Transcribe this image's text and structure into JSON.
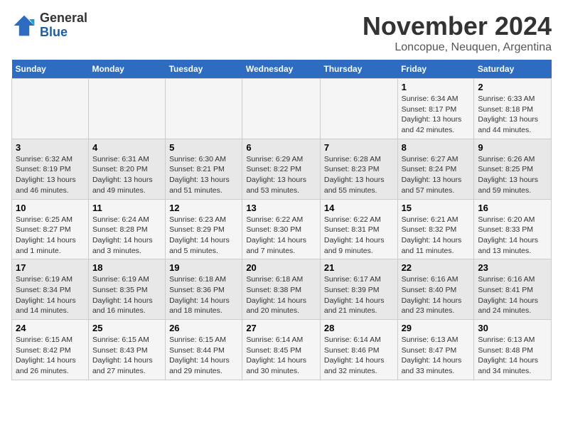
{
  "header": {
    "logo_general": "General",
    "logo_blue": "Blue",
    "title": "November 2024",
    "subtitle": "Loncopue, Neuquen, Argentina"
  },
  "weekdays": [
    "Sunday",
    "Monday",
    "Tuesday",
    "Wednesday",
    "Thursday",
    "Friday",
    "Saturday"
  ],
  "weeks": [
    [
      {
        "day": "",
        "detail": ""
      },
      {
        "day": "",
        "detail": ""
      },
      {
        "day": "",
        "detail": ""
      },
      {
        "day": "",
        "detail": ""
      },
      {
        "day": "",
        "detail": ""
      },
      {
        "day": "1",
        "detail": "Sunrise: 6:34 AM\nSunset: 8:17 PM\nDaylight: 13 hours and 42 minutes."
      },
      {
        "day": "2",
        "detail": "Sunrise: 6:33 AM\nSunset: 8:18 PM\nDaylight: 13 hours and 44 minutes."
      }
    ],
    [
      {
        "day": "3",
        "detail": "Sunrise: 6:32 AM\nSunset: 8:19 PM\nDaylight: 13 hours and 46 minutes."
      },
      {
        "day": "4",
        "detail": "Sunrise: 6:31 AM\nSunset: 8:20 PM\nDaylight: 13 hours and 49 minutes."
      },
      {
        "day": "5",
        "detail": "Sunrise: 6:30 AM\nSunset: 8:21 PM\nDaylight: 13 hours and 51 minutes."
      },
      {
        "day": "6",
        "detail": "Sunrise: 6:29 AM\nSunset: 8:22 PM\nDaylight: 13 hours and 53 minutes."
      },
      {
        "day": "7",
        "detail": "Sunrise: 6:28 AM\nSunset: 8:23 PM\nDaylight: 13 hours and 55 minutes."
      },
      {
        "day": "8",
        "detail": "Sunrise: 6:27 AM\nSunset: 8:24 PM\nDaylight: 13 hours and 57 minutes."
      },
      {
        "day": "9",
        "detail": "Sunrise: 6:26 AM\nSunset: 8:25 PM\nDaylight: 13 hours and 59 minutes."
      }
    ],
    [
      {
        "day": "10",
        "detail": "Sunrise: 6:25 AM\nSunset: 8:27 PM\nDaylight: 14 hours and 1 minute."
      },
      {
        "day": "11",
        "detail": "Sunrise: 6:24 AM\nSunset: 8:28 PM\nDaylight: 14 hours and 3 minutes."
      },
      {
        "day": "12",
        "detail": "Sunrise: 6:23 AM\nSunset: 8:29 PM\nDaylight: 14 hours and 5 minutes."
      },
      {
        "day": "13",
        "detail": "Sunrise: 6:22 AM\nSunset: 8:30 PM\nDaylight: 14 hours and 7 minutes."
      },
      {
        "day": "14",
        "detail": "Sunrise: 6:22 AM\nSunset: 8:31 PM\nDaylight: 14 hours and 9 minutes."
      },
      {
        "day": "15",
        "detail": "Sunrise: 6:21 AM\nSunset: 8:32 PM\nDaylight: 14 hours and 11 minutes."
      },
      {
        "day": "16",
        "detail": "Sunrise: 6:20 AM\nSunset: 8:33 PM\nDaylight: 14 hours and 13 minutes."
      }
    ],
    [
      {
        "day": "17",
        "detail": "Sunrise: 6:19 AM\nSunset: 8:34 PM\nDaylight: 14 hours and 14 minutes."
      },
      {
        "day": "18",
        "detail": "Sunrise: 6:19 AM\nSunset: 8:35 PM\nDaylight: 14 hours and 16 minutes."
      },
      {
        "day": "19",
        "detail": "Sunrise: 6:18 AM\nSunset: 8:36 PM\nDaylight: 14 hours and 18 minutes."
      },
      {
        "day": "20",
        "detail": "Sunrise: 6:18 AM\nSunset: 8:38 PM\nDaylight: 14 hours and 20 minutes."
      },
      {
        "day": "21",
        "detail": "Sunrise: 6:17 AM\nSunset: 8:39 PM\nDaylight: 14 hours and 21 minutes."
      },
      {
        "day": "22",
        "detail": "Sunrise: 6:16 AM\nSunset: 8:40 PM\nDaylight: 14 hours and 23 minutes."
      },
      {
        "day": "23",
        "detail": "Sunrise: 6:16 AM\nSunset: 8:41 PM\nDaylight: 14 hours and 24 minutes."
      }
    ],
    [
      {
        "day": "24",
        "detail": "Sunrise: 6:15 AM\nSunset: 8:42 PM\nDaylight: 14 hours and 26 minutes."
      },
      {
        "day": "25",
        "detail": "Sunrise: 6:15 AM\nSunset: 8:43 PM\nDaylight: 14 hours and 27 minutes."
      },
      {
        "day": "26",
        "detail": "Sunrise: 6:15 AM\nSunset: 8:44 PM\nDaylight: 14 hours and 29 minutes."
      },
      {
        "day": "27",
        "detail": "Sunrise: 6:14 AM\nSunset: 8:45 PM\nDaylight: 14 hours and 30 minutes."
      },
      {
        "day": "28",
        "detail": "Sunrise: 6:14 AM\nSunset: 8:46 PM\nDaylight: 14 hours and 32 minutes."
      },
      {
        "day": "29",
        "detail": "Sunrise: 6:13 AM\nSunset: 8:47 PM\nDaylight: 14 hours and 33 minutes."
      },
      {
        "day": "30",
        "detail": "Sunrise: 6:13 AM\nSunset: 8:48 PM\nDaylight: 14 hours and 34 minutes."
      }
    ]
  ]
}
